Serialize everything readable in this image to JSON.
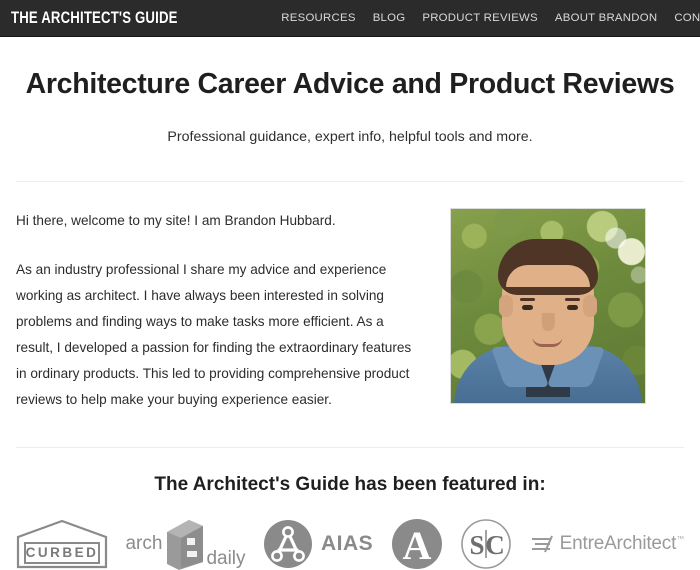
{
  "header": {
    "brand": "THE ARCHITECT'S GUIDE",
    "nav": [
      {
        "label": "RESOURCES"
      },
      {
        "label": "BLOG"
      },
      {
        "label": "PRODUCT REVIEWS"
      },
      {
        "label": "ABOUT BRANDON"
      },
      {
        "label": "CONTACT"
      }
    ],
    "bar_color": "#2b2b2b",
    "nav_text_color": "#d9d9d9"
  },
  "hero": {
    "title": "Architecture Career Advice and Product Reviews",
    "subtitle": "Professional guidance, expert info, helpful tools and more."
  },
  "intro": {
    "paragraph_1": "Hi there, welcome to my site! I am Brandon Hubbard.",
    "paragraph_2": "As an industry professional I share my advice and experience working as architect. I have always been interested in solving problems and finding ways to make tasks more efficient. As a result, I developed a passion for finding the extraordinary features in ordinary products. This led to providing comprehensive product reviews to help make your buying experience easier.",
    "photo_alt": "Portrait of Brandon Hubbard in a denim shirt outdoors"
  },
  "featured": {
    "title": "The Architect's Guide has been featured in:",
    "logos": [
      {
        "name": "curbed-logo",
        "label": "CURBED"
      },
      {
        "name": "archdaily-logo",
        "label_first": "arch",
        "label_second": "daily"
      },
      {
        "name": "aias-logo",
        "label": "AIAS"
      },
      {
        "name": "archinect-logo",
        "label": "A"
      },
      {
        "name": "sc-logo",
        "label_left": "S",
        "label_right": "C"
      },
      {
        "name": "entrearchitect-logo",
        "label": "EntreArchitect",
        "trademark": "™"
      }
    ]
  },
  "colors": {
    "header_bg": "#2b2b2b",
    "body_text": "#2c2c2c",
    "heading": "#1f1f1f",
    "rule": "#ececec",
    "logo_gray": "#8a8a8a"
  }
}
